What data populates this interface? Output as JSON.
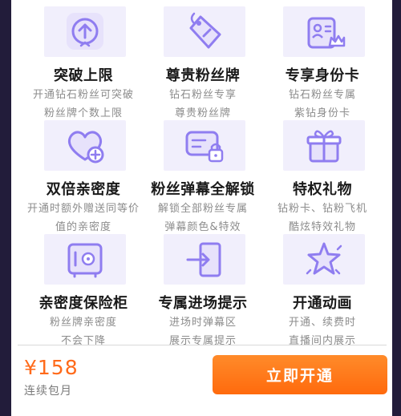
{
  "colors": {
    "accent": "#ff6a1a",
    "icon": "#8f7df0",
    "icon_bg": "#f1effc"
  },
  "perks": [
    {
      "icon": "arrow-up-icon",
      "title": "突破上限",
      "desc1": "开通钻石粉丝可突破",
      "desc2": "粉丝牌个数上限"
    },
    {
      "icon": "tag-icon",
      "title": "尊贵粉丝牌",
      "desc1": "钻石粉丝专享",
      "desc2": "尊贵粉丝牌"
    },
    {
      "icon": "id-card-icon",
      "title": "专享身份卡",
      "desc1": "钻石粉丝专属",
      "desc2": "紫钻身份卡"
    },
    {
      "icon": "heart-plus-icon",
      "title": "双倍亲密度",
      "desc1": "开通时额外赠送同等价",
      "desc2": "值的亲密度"
    },
    {
      "icon": "chat-lock-icon",
      "title": "粉丝弹幕全解锁",
      "desc1": "解锁全部粉丝专属",
      "desc2": "弹幕颜色&特效"
    },
    {
      "icon": "gift-icon",
      "title": "特权礼物",
      "desc1": "钻粉卡、钻粉飞机",
      "desc2": "酷炫特效礼物"
    },
    {
      "icon": "safe-icon",
      "title": "亲密度保险柜",
      "desc1": "粉丝牌亲密度",
      "desc2": "不会下降"
    },
    {
      "icon": "enter-door-icon",
      "title": "专属进场提示",
      "desc1": "进场时弹幕区",
      "desc2": "展示专属提示"
    },
    {
      "icon": "star-sparkle-icon",
      "title": "开通动画",
      "desc1": "开通、续费时",
      "desc2": "直播间内展示"
    }
  ],
  "footer": {
    "price": "¥158",
    "period": "连续包月",
    "button_label": "立即开通"
  }
}
